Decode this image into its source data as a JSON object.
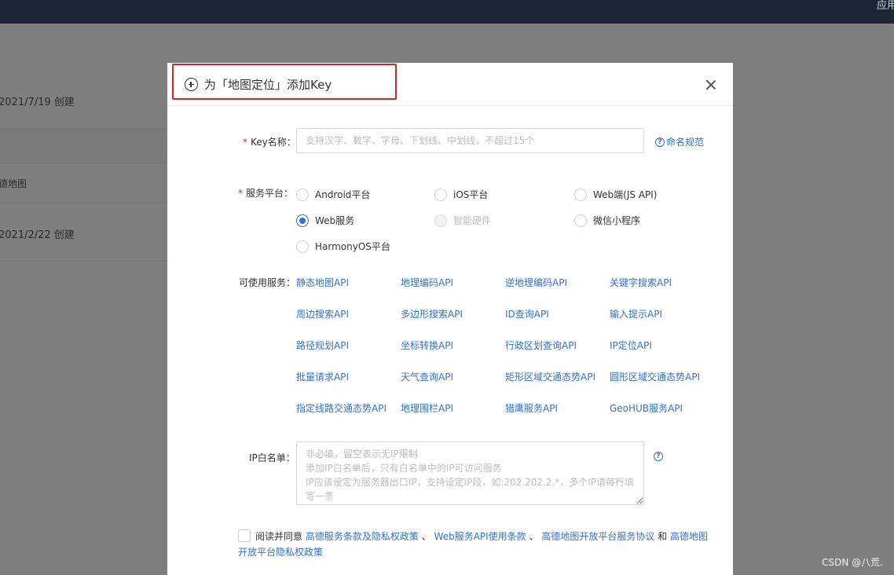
{
  "topbar": {
    "right_text": "应用"
  },
  "background": {
    "row1": "2021/7/19 创建",
    "row2": "高德地图",
    "row3": "2021/2/22 创建"
  },
  "modal": {
    "title": "为「地图定位」添加Key",
    "key_name": {
      "label": "Key名称：",
      "placeholder": "支持汉字、数字、字母、下划线、中划线，不超过15个",
      "value": "",
      "help": "命名规范"
    },
    "platform": {
      "label": "服务平台：",
      "options": [
        {
          "label": "Android平台",
          "checked": false,
          "disabled": false
        },
        {
          "label": "iOS平台",
          "checked": false,
          "disabled": false
        },
        {
          "label": "Web端(JS API)",
          "checked": false,
          "disabled": false
        },
        {
          "label": "Web服务",
          "checked": true,
          "disabled": false
        },
        {
          "label": "智能硬件",
          "checked": false,
          "disabled": true
        },
        {
          "label": "微信小程序",
          "checked": false,
          "disabled": false
        },
        {
          "label": "HarmonyOS平台",
          "checked": false,
          "disabled": false
        }
      ]
    },
    "services": {
      "label": "可使用服务：",
      "items": [
        "静态地图API",
        "地理编码API",
        "逆地理编码API",
        "关键字搜索API",
        "周边搜索API",
        "多边形搜索API",
        "ID查询API",
        "输入提示API",
        "路径规划API",
        "坐标转换API",
        "行政区划查询API",
        "IP定位API",
        "批量请求API",
        "天气查询API",
        "矩形区域交通态势API",
        "圆形区域交通态势API",
        "指定线路交通态势API",
        "地理围栏API",
        "猎鹰服务API",
        "GeoHUB服务API"
      ]
    },
    "ip_whitelist": {
      "label": "IP白名单：",
      "placeholder": "非必填，留空表示无IP限制\n添加IP白名单后，只有白名单中的IP可访问服务\nIP应该设定为服务器出口IP，支持设定IP段，如:202.202.2.*，多个IP请每行填写一条",
      "value": "",
      "help_icon": "?"
    },
    "agreement": {
      "prefix": "阅读并同意",
      "link1": "高德服务条款及隐私权政策",
      "sep1": "、",
      "link2": "Web服务API使用条款",
      "sep2": "、",
      "link3": "高德地图开放平台服务协议",
      "and": "和",
      "link4": "高德地图开放平台隐私权政策",
      "checked": false
    }
  },
  "watermark": "CSDN @八荒."
}
